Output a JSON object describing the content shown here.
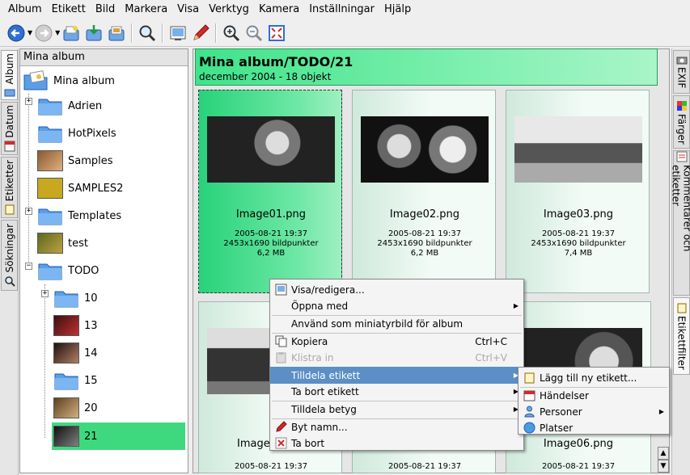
{
  "menubar": [
    "Album",
    "Etikett",
    "Bild",
    "Markera",
    "Visa",
    "Verktyg",
    "Kamera",
    "Inställningar",
    "Hjälp"
  ],
  "toolbar": {
    "icons": [
      "back-icon",
      "forward-icon",
      "new-album-icon",
      "add-images-icon",
      "album-properties-icon",
      "search-icon",
      "slideshow-icon",
      "edit-icon",
      "zoom-in-icon",
      "zoom-out-icon",
      "fullscreen-icon"
    ]
  },
  "left_tabs": [
    "Album",
    "Datum",
    "Etiketter",
    "Sökningar"
  ],
  "right_tabs": [
    "EXIF",
    "Färger",
    "Kommentarer och etiketter",
    "Etikettfilter"
  ],
  "album_panel": {
    "header": "Mina album",
    "root": "Mina album",
    "items": [
      "Adrien",
      "HotPixels",
      "Samples",
      "SAMPLES2",
      "Templates",
      "test",
      "TODO",
      "10",
      "13",
      "14",
      "15",
      "20",
      "21"
    ]
  },
  "main": {
    "title": "Mina album/TODO/21",
    "subtitle": "december 2004 - 18 objekt"
  },
  "cards": [
    {
      "name": "Image01.png",
      "date": "2005-08-21 19:37",
      "dims": "2453x1690 bildpunkter",
      "size": "6,2 MB"
    },
    {
      "name": "Image02.png",
      "date": "2005-08-21 19:37",
      "dims": "2453x1690 bildpunkter",
      "size": "6,2 MB"
    },
    {
      "name": "Image03.png",
      "date": "2005-08-21 19:37",
      "dims": "2453x1690 bildpunkter",
      "size": "7,4 MB"
    },
    {
      "name": "Image",
      "date": "2005-08-21 19:37"
    },
    {
      "name": "",
      "date": "2005-08-21 19:37"
    },
    {
      "name": "Image06.png",
      "date": "2005-08-21 19:37"
    }
  ],
  "context_menu": {
    "items": [
      {
        "label": "Visa/redigera...",
        "shortcut": "",
        "submenu": false
      },
      {
        "label": "Öppna med",
        "shortcut": "",
        "submenu": true
      },
      {
        "label": "Använd som miniatyrbild för album",
        "shortcut": "",
        "submenu": false
      },
      {
        "label": "Kopiera",
        "shortcut": "Ctrl+C",
        "submenu": false
      },
      {
        "label": "Klistra in",
        "shortcut": "Ctrl+V",
        "submenu": false
      },
      {
        "label": "Tilldela etikett",
        "shortcut": "",
        "submenu": true
      },
      {
        "label": "Ta bort etikett",
        "shortcut": "",
        "submenu": true
      },
      {
        "label": "Tilldela betyg",
        "shortcut": "",
        "submenu": true
      },
      {
        "label": "Byt namn...",
        "shortcut": "",
        "submenu": false
      },
      {
        "label": "Ta bort",
        "shortcut": "",
        "submenu": false
      }
    ],
    "highlight_color": "#5b8fc6"
  },
  "submenu": {
    "items": [
      {
        "label": "Lägg till ny etikett...",
        "submenu": false
      },
      {
        "label": "Händelser",
        "submenu": false
      },
      {
        "label": "Personer",
        "submenu": true
      },
      {
        "label": "Platser",
        "submenu": false
      }
    ]
  },
  "colors": {
    "header_green": "#3fe38a",
    "selection_green": "#28d27a"
  }
}
